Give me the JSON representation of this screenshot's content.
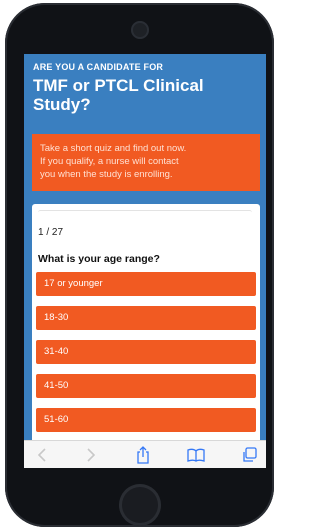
{
  "hero": {
    "eyebrow": "ARE YOU A CANDIDATE FOR",
    "headline_line1": "TMF or PTCL Clinical",
    "headline_line2": "Study?"
  },
  "promo": {
    "line1": "Take a short quiz and find out now.",
    "line2": "If you qualify, a nurse will contact",
    "line3": "you when the study is enrolling."
  },
  "quiz": {
    "progress": "1 / 27",
    "question": "What is your age range?",
    "options": [
      "17 or younger",
      "18-30",
      "31-40",
      "41-50",
      "51-60"
    ]
  },
  "toolbar": {
    "icons": [
      "back-icon",
      "forward-icon",
      "share-icon",
      "bookmarks-icon",
      "tabs-icon"
    ]
  },
  "colors": {
    "hero_blue": "#3a7fc0",
    "accent_orange": "#f15a22",
    "device_black": "#101216"
  }
}
